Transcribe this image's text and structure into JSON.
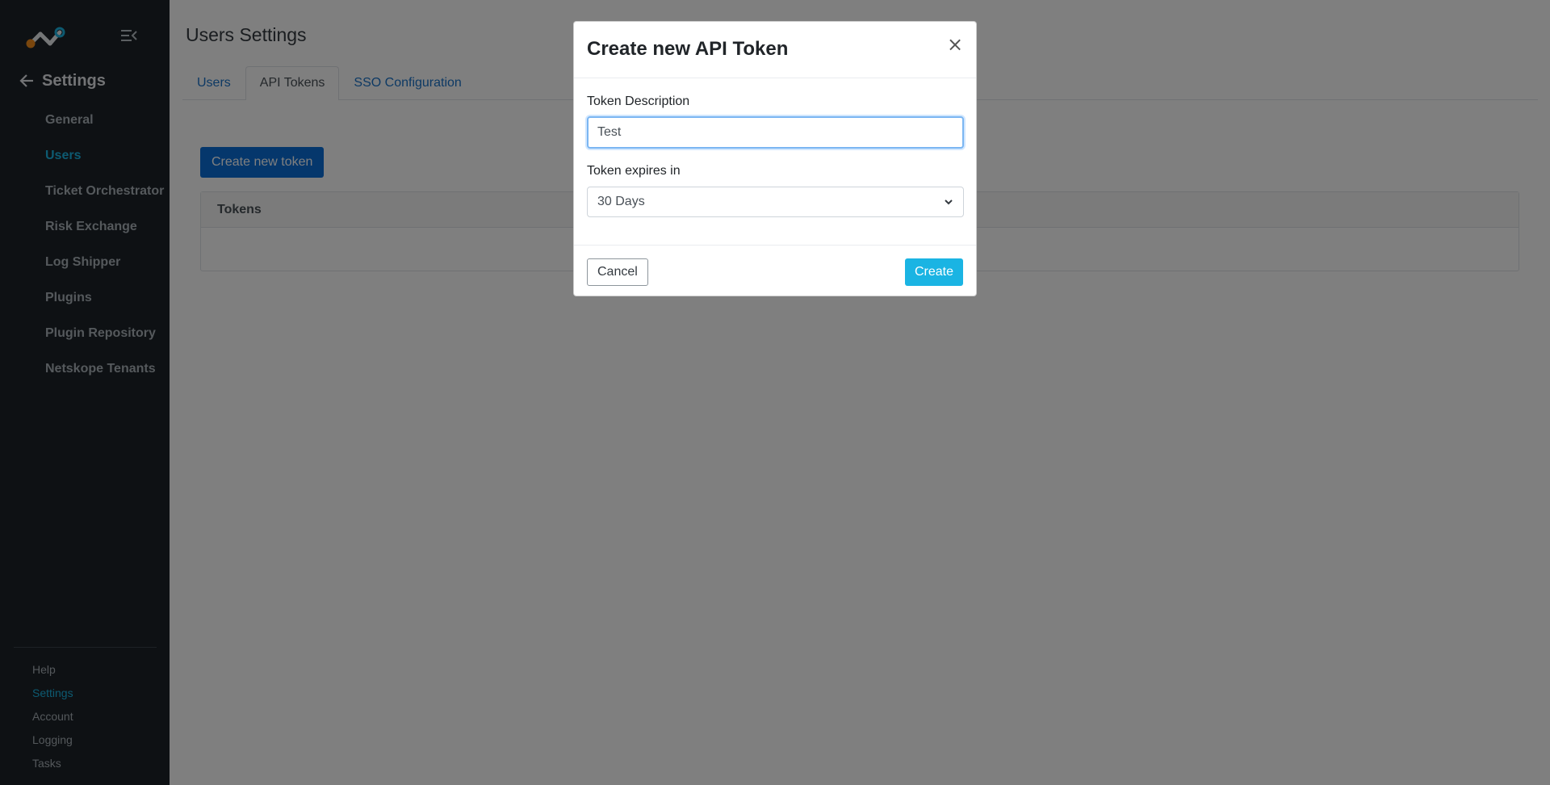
{
  "sidebar": {
    "logo_icon": "netskope-logo-icon",
    "collapse_icon": "menu-collapse-icon",
    "back_icon": "arrow-left-icon",
    "section_title": "Settings",
    "items": [
      {
        "label": "General",
        "active": false
      },
      {
        "label": "Users",
        "active": true
      },
      {
        "label": "Ticket Orchestrator",
        "active": false
      },
      {
        "label": "Risk Exchange",
        "active": false
      },
      {
        "label": "Log Shipper",
        "active": false
      },
      {
        "label": "Plugins",
        "active": false
      },
      {
        "label": "Plugin Repository",
        "active": false
      },
      {
        "label": "Netskope Tenants",
        "active": false
      }
    ],
    "bottom_items": [
      {
        "label": "Help",
        "active": false
      },
      {
        "label": "Settings",
        "active": true
      },
      {
        "label": "Account",
        "active": false
      },
      {
        "label": "Logging",
        "active": false
      },
      {
        "label": "Tasks",
        "active": false
      }
    ]
  },
  "main": {
    "title": "Users Settings",
    "tabs": [
      {
        "label": "Users",
        "active": false
      },
      {
        "label": "API Tokens",
        "active": true
      },
      {
        "label": "SSO Configuration",
        "active": false
      }
    ],
    "create_button": "Create new token",
    "tokens_header": "Tokens"
  },
  "modal": {
    "title": "Create new API Token",
    "close_icon": "close-icon",
    "description_label": "Token Description",
    "description_value": "Test",
    "expiry_label": "Token expires in",
    "expiry_selected": "30 Days",
    "cancel_label": "Cancel",
    "create_label": "Create"
  },
  "colors": {
    "sidebar_bg": "#1c2329",
    "accent": "#1ab4e3",
    "primary_button": "#0b6fd8",
    "link": "#1a73c9"
  }
}
